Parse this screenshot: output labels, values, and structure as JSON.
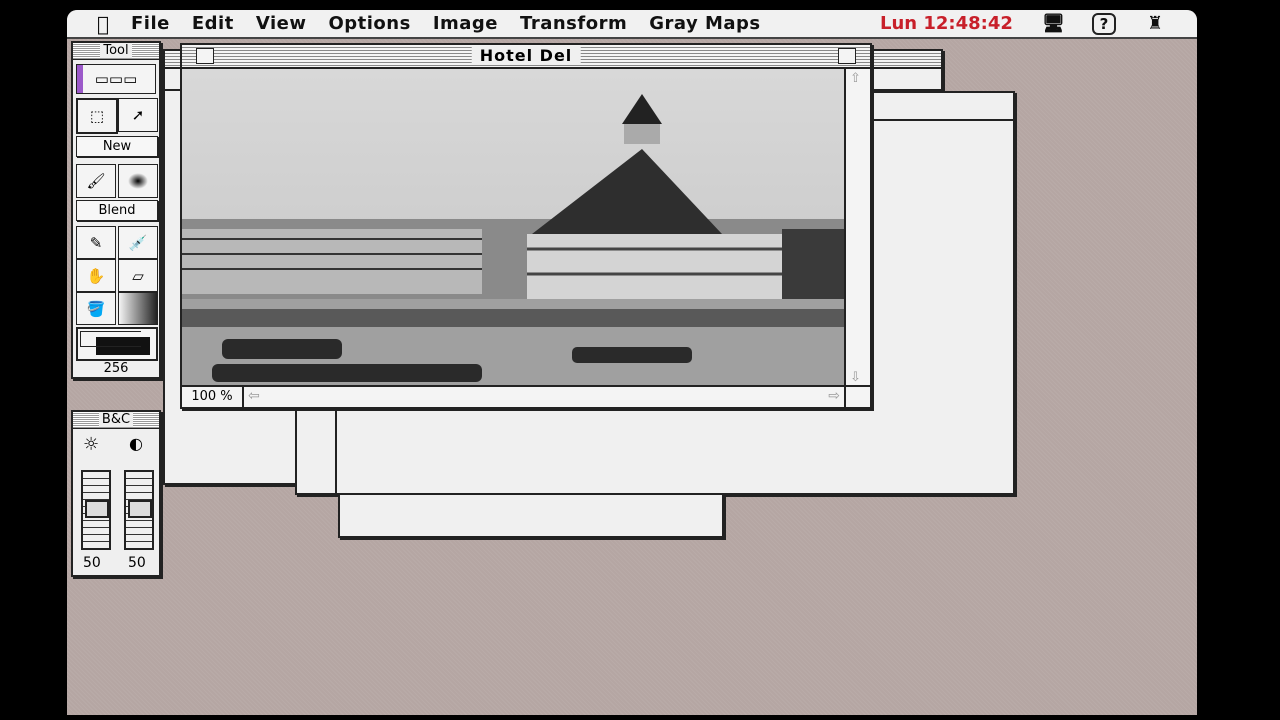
{
  "menubar": {
    "apple": "",
    "items": [
      "File",
      "Edit",
      "View",
      "Options",
      "Image",
      "Transform",
      "Gray Maps"
    ],
    "clock": "Lun 12:48:42",
    "clock_color": "#c8202a",
    "icons": [
      "monitor-icon",
      "help-balloon-icon",
      "application-menu-icon"
    ]
  },
  "tool_palette": {
    "title": "Tool",
    "new_label": "New",
    "blend_label": "Blend",
    "color_count": "256",
    "tools": [
      "marquee-icon",
      "arrow-icon",
      "brush-icon",
      "airbrush-icon",
      "pencil-icon",
      "eyedropper-icon",
      "hand-icon",
      "eraser-icon",
      "paint-bucket-icon",
      "gradient-icon"
    ]
  },
  "bc_palette": {
    "title": "B&C",
    "brightness": "50",
    "contrast": "50"
  },
  "main_window": {
    "title": "Hotel Del",
    "zoom": "100 %"
  }
}
